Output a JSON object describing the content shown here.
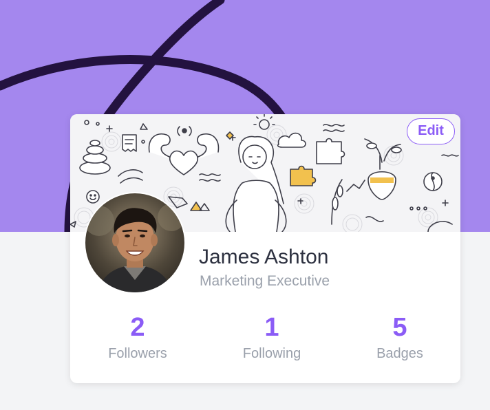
{
  "colors": {
    "accent": "#8b5cf6",
    "hero_background": "#a487ee",
    "hero_stroke": "#23123f",
    "page_background": "#f3f4f6",
    "card_background": "#ffffff",
    "name_text": "#2d3140",
    "muted_text": "#9aa0ab"
  },
  "card": {
    "edit_label": "Edit",
    "cover_image": "doodle-illustration",
    "avatar_image": "profile-photo"
  },
  "profile": {
    "name": "James Ashton",
    "title": "Marketing Executive"
  },
  "stats": [
    {
      "value": "2",
      "label": "Followers"
    },
    {
      "value": "1",
      "label": "Following"
    },
    {
      "value": "5",
      "label": "Badges"
    }
  ]
}
